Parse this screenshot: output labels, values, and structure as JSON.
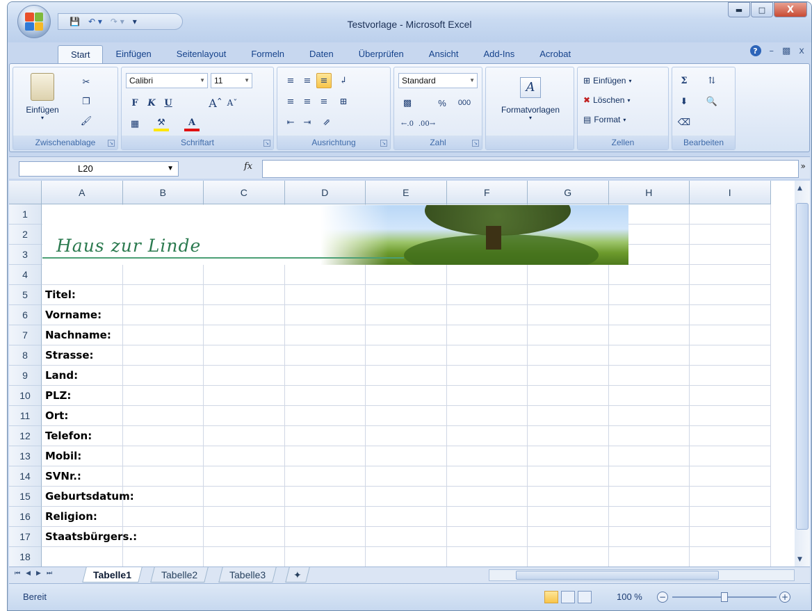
{
  "window": {
    "title": "Testvorlage - Microsoft Excel",
    "qat_items": [
      "save-icon",
      "undo-icon",
      "redo-icon",
      "customize-icon"
    ]
  },
  "tabs": [
    "Start",
    "Einfügen",
    "Seitenlayout",
    "Formeln",
    "Daten",
    "Überprüfen",
    "Ansicht",
    "Add-Ins",
    "Acrobat"
  ],
  "active_tab": "Start",
  "ribbon": {
    "clipboard": {
      "label": "Zwischenablage",
      "paste": "Einfügen"
    },
    "font": {
      "label": "Schriftart",
      "name": "Calibri",
      "size": "11",
      "bold": "F",
      "italic": "K",
      "underline": "U"
    },
    "alignment": {
      "label": "Ausrichtung"
    },
    "number": {
      "label": "Zahl",
      "format": "Standard",
      "percent": "%",
      "thousands": "000"
    },
    "styles": {
      "label": "Formatvorlagen"
    },
    "cells": {
      "label": "Zellen",
      "insert": "Einfügen",
      "delete": "Löschen",
      "format": "Format"
    },
    "editing": {
      "label": "Bearbeiten",
      "sum": "Σ"
    }
  },
  "formula_bar": {
    "name_box": "L20",
    "fx": "fx",
    "formula": ""
  },
  "columns": [
    "A",
    "B",
    "C",
    "D",
    "E",
    "F",
    "G",
    "H",
    "I"
  ],
  "rows": [
    "1",
    "2",
    "3",
    "4",
    "5",
    "6",
    "7",
    "8",
    "9",
    "10",
    "11",
    "12",
    "13",
    "14",
    "15",
    "16",
    "17",
    "18"
  ],
  "banner": {
    "text": "Haus zur Linde"
  },
  "labels": [
    {
      "row": 5,
      "text": "Titel:"
    },
    {
      "row": 6,
      "text": "Vorname:"
    },
    {
      "row": 7,
      "text": "Nachname:"
    },
    {
      "row": 8,
      "text": "Strasse:"
    },
    {
      "row": 9,
      "text": "Land:"
    },
    {
      "row": 10,
      "text": "PLZ:"
    },
    {
      "row": 11,
      "text": "Ort:"
    },
    {
      "row": 12,
      "text": "Telefon:"
    },
    {
      "row": 13,
      "text": "Mobil:"
    },
    {
      "row": 14,
      "text": "SVNr.:"
    },
    {
      "row": 15,
      "text": "Geburtsdatum:"
    },
    {
      "row": 16,
      "text": "Religion:"
    },
    {
      "row": 17,
      "text": "Staatsbürgers.:"
    }
  ],
  "sheet_tabs": [
    "Tabelle1",
    "Tabelle2",
    "Tabelle3"
  ],
  "active_sheet": "Tabelle1",
  "status": {
    "text": "Bereit",
    "zoom": "100 %"
  }
}
